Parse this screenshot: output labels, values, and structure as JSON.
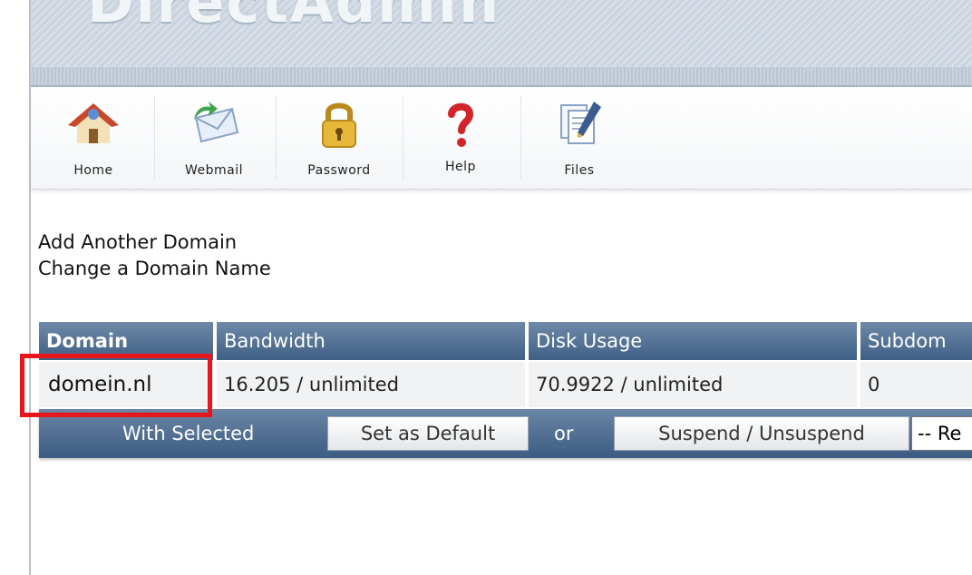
{
  "header": {
    "logo_text": "DirectAdmin"
  },
  "toolbar": {
    "items": [
      {
        "label": "Home",
        "icon": "house-icon"
      },
      {
        "label": "Webmail",
        "icon": "envelope-icon"
      },
      {
        "label": "Password",
        "icon": "padlock-icon"
      },
      {
        "label": "Help",
        "icon": "question-mark-icon"
      },
      {
        "label": "Files",
        "icon": "files-icon"
      }
    ]
  },
  "links": {
    "add_domain": "Add Another Domain",
    "change_domain": "Change a Domain Name"
  },
  "table": {
    "headers": [
      "Domain",
      "Bandwidth",
      "Disk Usage",
      "Subdom"
    ],
    "rows": [
      {
        "domain": "domein.nl",
        "bandwidth": "16.205 / unlimited",
        "disk_usage": "70.9922 / unlimited",
        "subdomains": "0"
      }
    ]
  },
  "actions": {
    "with_selected": "With Selected",
    "set_default": "Set as Default",
    "or": "or",
    "suspend": "Suspend / Unsuspend",
    "select_value": "-- Re"
  },
  "colors": {
    "header_blue": "#3f5f85",
    "highlight_red": "#e8161c"
  }
}
